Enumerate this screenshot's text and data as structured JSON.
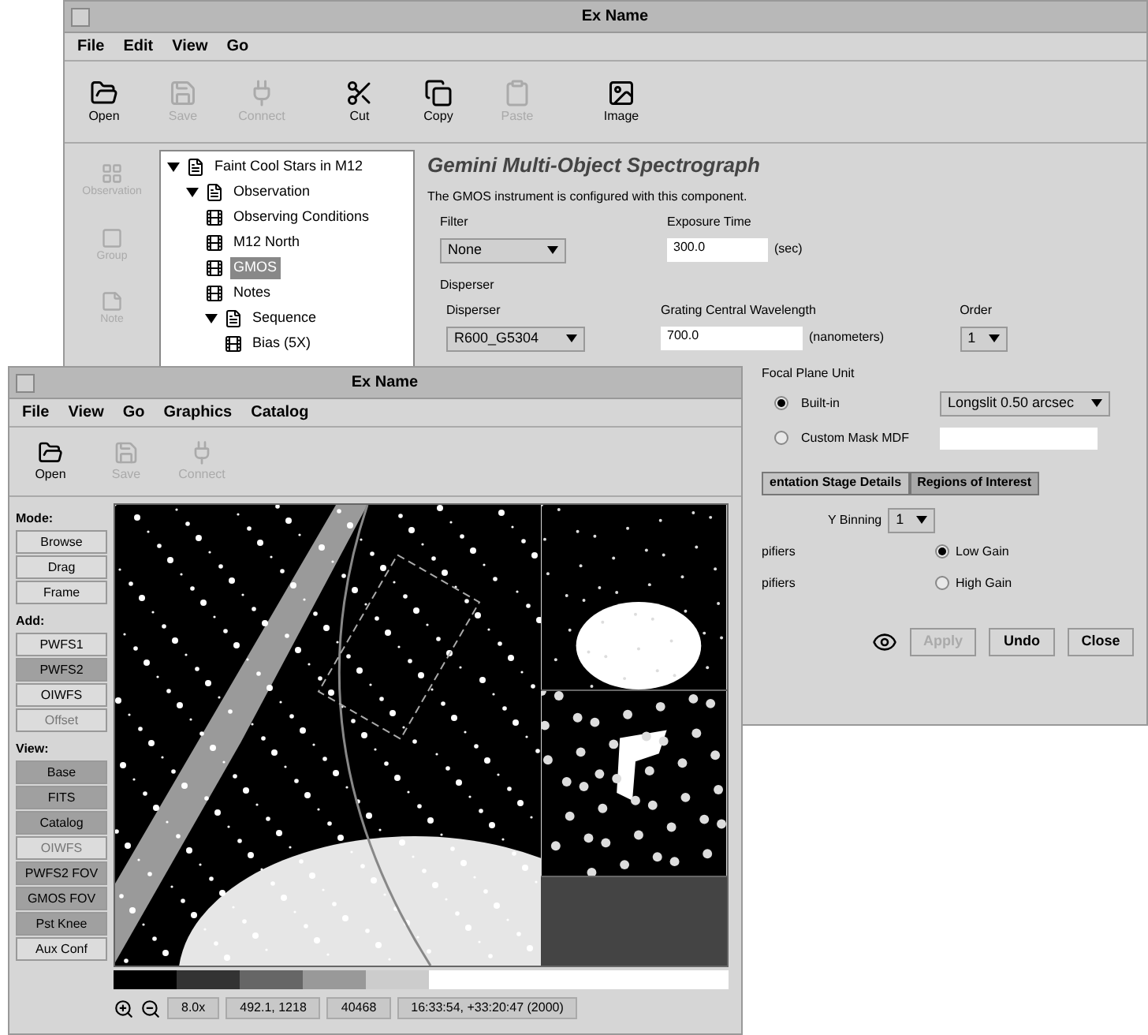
{
  "back_window": {
    "title": "Ex Name",
    "menu": [
      "File",
      "Edit",
      "View",
      "Go"
    ],
    "toolbar": [
      {
        "label": "Open",
        "disabled": false
      },
      {
        "label": "Save",
        "disabled": true
      },
      {
        "label": "Connect",
        "disabled": true
      },
      {
        "label": "Cut",
        "disabled": false
      },
      {
        "label": "Copy",
        "disabled": false
      },
      {
        "label": "Paste",
        "disabled": true
      },
      {
        "label": "Image",
        "disabled": false
      }
    ],
    "sidebar": [
      {
        "label": "Observation",
        "disabled": true
      },
      {
        "label": "Group",
        "disabled": true
      },
      {
        "label": "Note",
        "disabled": true
      }
    ],
    "tree": [
      {
        "label": "Faint Cool Stars in M12",
        "selected": false,
        "expanded": true,
        "children": [
          {
            "label": "Observation",
            "selected": false,
            "expanded": true,
            "children": [
              {
                "label": "Observing Conditions",
                "selected": false
              },
              {
                "label": "M12 North",
                "selected": false
              },
              {
                "label": "GMOS",
                "selected": true
              },
              {
                "label": "Notes",
                "selected": false
              },
              {
                "label": "Sequence",
                "selected": false,
                "expanded": true,
                "children": [
                  {
                    "label": "Bias (5X)",
                    "selected": false
                  }
                ]
              }
            ]
          }
        ]
      }
    ],
    "panel": {
      "title": "Gemini Multi-Object Spectrograph",
      "description": "The GMOS instrument is configured with this component.",
      "filter_label": "Filter",
      "filter": "None",
      "exposure_label": "Exposure Time",
      "exposure": "300.0",
      "exposure_unit": "(sec)",
      "disperser_group": "Disperser",
      "disperser_label": "Disperser",
      "disperser": "R600_G5304",
      "wavelength_label": "Grating Central Wavelength",
      "wavelength": "700.0",
      "wavelength_unit": "(nanometers)",
      "order_label": "Order",
      "order": "1",
      "fpu_group": "Focal Plane Unit",
      "fpu_options": [
        {
          "label": "Built-in",
          "selected": true
        },
        {
          "label": "Custom Mask MDF",
          "selected": false
        }
      ],
      "fpu_value": "Longslit 0.50 arcsec",
      "tabs": [
        {
          "label": "entation Stage Details",
          "selected": false
        },
        {
          "label": "Regions of Interest",
          "selected": true
        }
      ],
      "ybin_label": "Y Binning",
      "ybin": "1",
      "amp_rows": [
        "pifiers",
        "pifiers"
      ],
      "gain_options": [
        {
          "label": "Low Gain",
          "selected": true
        },
        {
          "label": "High Gain",
          "selected": false
        }
      ]
    },
    "buttons": [
      {
        "label": "Apply",
        "disabled": true
      },
      {
        "label": "Undo",
        "disabled": false
      },
      {
        "label": "Close",
        "disabled": false
      }
    ]
  },
  "front_window": {
    "title": "Ex Name",
    "menu": [
      "File",
      "View",
      "Go",
      "Graphics",
      "Catalog"
    ],
    "toolbar": [
      {
        "label": "Open",
        "disabled": false
      },
      {
        "label": "Save",
        "disabled": true
      },
      {
        "label": "Connect",
        "disabled": true
      }
    ],
    "controls": [
      {
        "kind": "heading",
        "label": "Mode:"
      },
      {
        "kind": "button",
        "label": "Browse",
        "selected": false,
        "disabled": false
      },
      {
        "kind": "button",
        "label": "Drag",
        "selected": false,
        "disabled": false
      },
      {
        "kind": "button",
        "label": "Frame",
        "selected": false,
        "disabled": false
      },
      {
        "kind": "heading",
        "label": "Add:"
      },
      {
        "kind": "button",
        "label": "PWFS1",
        "selected": false,
        "disabled": false
      },
      {
        "kind": "button",
        "label": "PWFS2",
        "selected": true,
        "disabled": false
      },
      {
        "kind": "button",
        "label": "OIWFS",
        "selected": false,
        "disabled": false
      },
      {
        "kind": "button",
        "label": "Offset",
        "selected": false,
        "disabled": true
      },
      {
        "kind": "heading",
        "label": "View:"
      },
      {
        "kind": "button",
        "label": "Base",
        "selected": true,
        "disabled": false
      },
      {
        "kind": "button",
        "label": "FITS",
        "selected": true,
        "disabled": false
      },
      {
        "kind": "button",
        "label": "Catalog",
        "selected": true,
        "disabled": false
      },
      {
        "kind": "button",
        "label": "OIWFS",
        "selected": false,
        "disabled": true
      },
      {
        "kind": "button",
        "label": "PWFS2 FOV",
        "selected": true,
        "disabled": false
      },
      {
        "kind": "button",
        "label": "GMOS FOV",
        "selected": true,
        "disabled": false
      },
      {
        "kind": "button",
        "label": "Pst Knee",
        "selected": true,
        "disabled": false
      },
      {
        "kind": "button",
        "label": "Aux Conf",
        "selected": false,
        "disabled": false
      }
    ],
    "status": [
      "8.0x",
      "492.1, 1218",
      "40468",
      "16:33:54, +33:20:47 (2000)"
    ]
  }
}
